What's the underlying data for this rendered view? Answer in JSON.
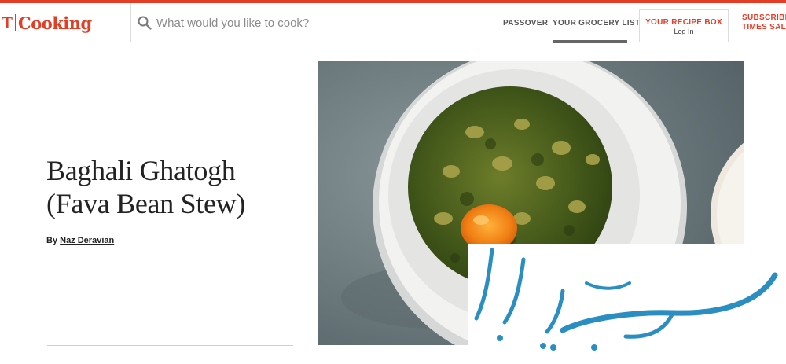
{
  "header": {
    "brand_t": "T",
    "brand_name": "Cooking",
    "search_placeholder": "What would you like to cook?",
    "nav": {
      "passover": "PASSOVER",
      "grocery": "YOUR GROCERY LIST"
    },
    "recipe_box": {
      "title": "YOUR RECIPE BOX",
      "subtitle": "Log In"
    },
    "subscribe": {
      "line1": "SUBSCRIBE:",
      "line2": "TIMES SALE"
    }
  },
  "recipe": {
    "title": "Baghali Ghatogh (Fava Bean Stew)",
    "by_prefix": "By",
    "author": "Naz Deravian"
  },
  "watermark": {
    "text": "سرمایه ایرانی",
    "color": "#2a8fc0"
  },
  "colors": {
    "accent": "#e33d26"
  },
  "icons": {
    "search": "search-icon"
  }
}
